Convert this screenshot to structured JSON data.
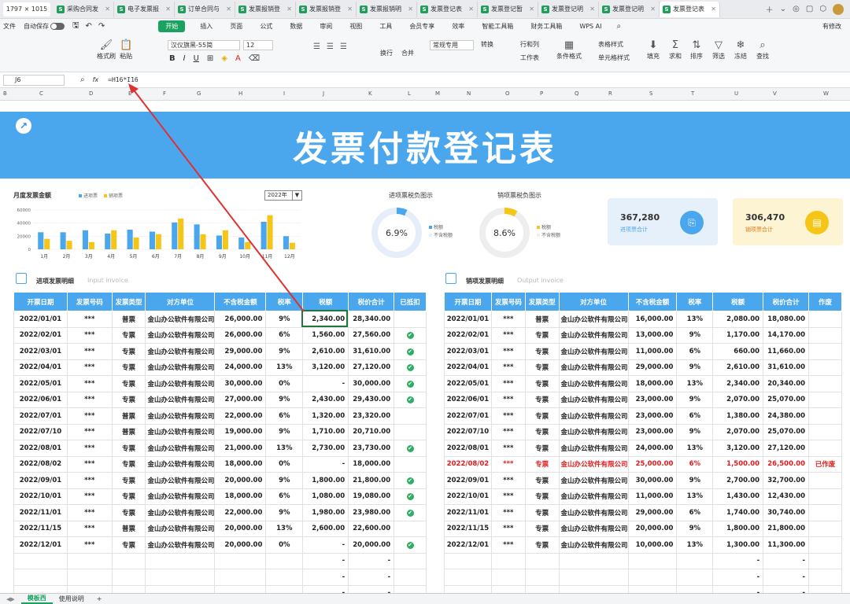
{
  "window": {
    "dimension_label": "1797 × 1015",
    "tabs": [
      {
        "label": "采购合同发"
      },
      {
        "label": "电子发票报"
      },
      {
        "label": "订单合同与"
      },
      {
        "label": "发票报销登"
      },
      {
        "label": "发票报销登"
      },
      {
        "label": "发票报销明"
      },
      {
        "label": "发票登记表"
      },
      {
        "label": "发票登记暂"
      },
      {
        "label": "发票登记明"
      },
      {
        "label": "发票登记明"
      },
      {
        "label": "发票登记表"
      }
    ]
  },
  "menu": {
    "file": "文件",
    "autosave": "自动保存",
    "items": [
      "开始",
      "插入",
      "页面",
      "公式",
      "数据",
      "审阅",
      "视图",
      "工具",
      "会员专享",
      "效率",
      "智能工具箱",
      "财务工具箱",
      "WPS AI"
    ],
    "share": "有修改"
  },
  "toolbar": {
    "format_painter": "格式刷",
    "paste": "粘贴",
    "font": "汉仪旗黑-55简",
    "size": "12",
    "wrap": "换行",
    "merge": "合并",
    "number_format": "常规专用",
    "convert": "转换",
    "row_col": "行和列",
    "worksheet": "工作表",
    "cond_format": "条件格式",
    "table_style": "表格样式",
    "cell_style": "单元格样式",
    "fill": "填充",
    "sum": "求和",
    "sort": "排序",
    "filter": "筛选",
    "freeze": "冻结",
    "find": "查找"
  },
  "formula": {
    "cell": "J6",
    "fx": "fx",
    "content": "=H16*I16"
  },
  "columns": [
    "B",
    "C",
    "D",
    "E",
    "F",
    "G",
    "H",
    "I",
    "J",
    "K",
    "L",
    "M",
    "N",
    "O",
    "P",
    "Q",
    "R",
    "S",
    "T",
    "U",
    "V",
    "W"
  ],
  "banner": {
    "title": "发票付款登记表"
  },
  "monthly": {
    "title": "月度发票金额",
    "legend_in": "进项票",
    "legend_out": "销项票",
    "year": "2022年"
  },
  "chart_data": {
    "type": "bar",
    "categories": [
      "1月",
      "2月",
      "3月",
      "4月",
      "5月",
      "6月",
      "7月",
      "8月",
      "9月",
      "10月",
      "11月",
      "12月"
    ],
    "series": [
      {
        "name": "进项票",
        "values": [
          26000,
          26000,
          29000,
          24000,
          30000,
          27000,
          41000,
          38000,
          21000,
          18000,
          42000,
          20000
        ],
        "color": "#4aa6ed"
      },
      {
        "name": "销项票",
        "values": [
          16000,
          13000,
          11000,
          29000,
          18000,
          23000,
          47000,
          23000,
          29000,
          11000,
          52000,
          10000
        ],
        "color": "#f5c518"
      }
    ],
    "yticks": [
      "60000",
      "40000",
      "20000",
      "0"
    ],
    "ylim": [
      0,
      60000
    ]
  },
  "donut_in": {
    "title": "进项票税负图示",
    "value": "6.9%",
    "fraction": 0.069,
    "legend1": "税额",
    "legend2": "不含税额"
  },
  "donut_out": {
    "title": "销项票税负图示",
    "value": "8.6%",
    "fraction": 0.086,
    "legend1": "税额",
    "legend2": "不含税额"
  },
  "card_in": {
    "value": "367,280",
    "label": "进项票合计"
  },
  "card_out": {
    "value": "306,470",
    "label": "销项票合计"
  },
  "input_section": {
    "title": "进项发票明细",
    "subtitle": "Input invoice"
  },
  "output_section": {
    "title": "销项发票明细",
    "subtitle": "Output invoice"
  },
  "input_headers": [
    "开票日期",
    "发票号码",
    "发票类型",
    "对方单位",
    "不含税金额",
    "税率",
    "税额",
    "税价合计",
    "已抵扣"
  ],
  "output_headers": [
    "开票日期",
    "发票号码",
    "发票类型",
    "对方单位",
    "不含税金额",
    "税率",
    "税额",
    "税价合计",
    "作废"
  ],
  "input_rows": [
    [
      "2022/01/01",
      "***",
      "普票",
      "金山办公软件有限公司",
      "26,000.00",
      "9%",
      "2,340.00",
      "28,340.00",
      ""
    ],
    [
      "2022/02/01",
      "***",
      "专票",
      "金山办公软件有限公司",
      "26,000.00",
      "6%",
      "1,560.00",
      "27,560.00",
      "✔"
    ],
    [
      "2022/03/01",
      "***",
      "专票",
      "金山办公软件有限公司",
      "29,000.00",
      "9%",
      "2,610.00",
      "31,610.00",
      "✔"
    ],
    [
      "2022/04/01",
      "***",
      "专票",
      "金山办公软件有限公司",
      "24,000.00",
      "13%",
      "3,120.00",
      "27,120.00",
      "✔"
    ],
    [
      "2022/05/01",
      "***",
      "专票",
      "金山办公软件有限公司",
      "30,000.00",
      "0%",
      "-",
      "30,000.00",
      "✔"
    ],
    [
      "2022/06/01",
      "***",
      "专票",
      "金山办公软件有限公司",
      "27,000.00",
      "9%",
      "2,430.00",
      "29,430.00",
      "✔"
    ],
    [
      "2022/07/01",
      "***",
      "普票",
      "金山办公软件有限公司",
      "22,000.00",
      "6%",
      "1,320.00",
      "23,320.00",
      ""
    ],
    [
      "2022/07/10",
      "***",
      "普票",
      "金山办公软件有限公司",
      "19,000.00",
      "9%",
      "1,710.00",
      "20,710.00",
      ""
    ],
    [
      "2022/08/01",
      "***",
      "专票",
      "金山办公软件有限公司",
      "21,000.00",
      "13%",
      "2,730.00",
      "23,730.00",
      "✔"
    ],
    [
      "2022/08/02",
      "***",
      "专票",
      "金山办公软件有限公司",
      "18,000.00",
      "0%",
      "-",
      "18,000.00",
      ""
    ],
    [
      "2022/09/01",
      "***",
      "专票",
      "金山办公软件有限公司",
      "20,000.00",
      "9%",
      "1,800.00",
      "21,800.00",
      "✔"
    ],
    [
      "2022/10/01",
      "***",
      "专票",
      "金山办公软件有限公司",
      "18,000.00",
      "6%",
      "1,080.00",
      "19,080.00",
      "✔"
    ],
    [
      "2022/11/01",
      "***",
      "专票",
      "金山办公软件有限公司",
      "22,000.00",
      "9%",
      "1,980.00",
      "23,980.00",
      "✔"
    ],
    [
      "2022/11/15",
      "***",
      "普票",
      "金山办公软件有限公司",
      "20,000.00",
      "13%",
      "2,600.00",
      "22,600.00",
      ""
    ],
    [
      "2022/12/01",
      "***",
      "专票",
      "金山办公软件有限公司",
      "20,000.00",
      "0%",
      "-",
      "20,000.00",
      "✔"
    ],
    [
      "",
      "",
      "",
      "",
      "",
      "",
      "-",
      "-",
      ""
    ],
    [
      "",
      "",
      "",
      "",
      "",
      "",
      "-",
      "-",
      ""
    ],
    [
      "",
      "",
      "",
      "",
      "",
      "",
      "-",
      "-",
      ""
    ]
  ],
  "output_rows": [
    [
      "2022/01/01",
      "***",
      "普票",
      "金山办公软件有限公司",
      "16,000.00",
      "13%",
      "2,080.00",
      "18,080.00",
      ""
    ],
    [
      "2022/02/01",
      "***",
      "专票",
      "金山办公软件有限公司",
      "13,000.00",
      "9%",
      "1,170.00",
      "14,170.00",
      ""
    ],
    [
      "2022/03/01",
      "***",
      "专票",
      "金山办公软件有限公司",
      "11,000.00",
      "6%",
      "660.00",
      "11,660.00",
      ""
    ],
    [
      "2022/04/01",
      "***",
      "专票",
      "金山办公软件有限公司",
      "29,000.00",
      "9%",
      "2,610.00",
      "31,610.00",
      ""
    ],
    [
      "2022/05/01",
      "***",
      "专票",
      "金山办公软件有限公司",
      "18,000.00",
      "13%",
      "2,340.00",
      "20,340.00",
      ""
    ],
    [
      "2022/06/01",
      "***",
      "专票",
      "金山办公软件有限公司",
      "23,000.00",
      "9%",
      "2,070.00",
      "25,070.00",
      ""
    ],
    [
      "2022/07/01",
      "***",
      "专票",
      "金山办公软件有限公司",
      "23,000.00",
      "6%",
      "1,380.00",
      "24,380.00",
      ""
    ],
    [
      "2022/07/10",
      "***",
      "专票",
      "金山办公软件有限公司",
      "23,000.00",
      "9%",
      "2,070.00",
      "25,070.00",
      ""
    ],
    [
      "2022/08/01",
      "***",
      "专票",
      "金山办公软件有限公司",
      "24,000.00",
      "13%",
      "3,120.00",
      "27,120.00",
      ""
    ],
    [
      "2022/08/02",
      "***",
      "专票",
      "金山办公软件有限公司",
      "25,000.00",
      "6%",
      "1,500.00",
      "26,500.00",
      "已作废"
    ],
    [
      "2022/09/01",
      "***",
      "专票",
      "金山办公软件有限公司",
      "30,000.00",
      "9%",
      "2,700.00",
      "32,700.00",
      ""
    ],
    [
      "2022/10/01",
      "***",
      "专票",
      "金山办公软件有限公司",
      "11,000.00",
      "13%",
      "1,430.00",
      "12,430.00",
      ""
    ],
    [
      "2022/11/01",
      "***",
      "专票",
      "金山办公软件有限公司",
      "29,000.00",
      "6%",
      "1,740.00",
      "30,740.00",
      ""
    ],
    [
      "2022/11/15",
      "***",
      "专票",
      "金山办公软件有限公司",
      "20,000.00",
      "9%",
      "1,800.00",
      "21,800.00",
      ""
    ],
    [
      "2022/12/01",
      "***",
      "专票",
      "金山办公软件有限公司",
      "10,000.00",
      "13%",
      "1,300.00",
      "11,300.00",
      ""
    ],
    [
      "",
      "",
      "",
      "",
      "",
      "",
      "-",
      "-",
      ""
    ],
    [
      "",
      "",
      "",
      "",
      "",
      "",
      "-",
      "-",
      ""
    ],
    [
      "",
      "",
      "",
      "",
      "",
      "",
      "-",
      "-",
      ""
    ]
  ],
  "sheets": {
    "active": "模板西",
    "other": "使用说明",
    "add": "+"
  },
  "colors": {
    "accent": "#4aa6ed",
    "yellow": "#f5c518",
    "green": "#1ba261",
    "void": "#e01b1b"
  }
}
